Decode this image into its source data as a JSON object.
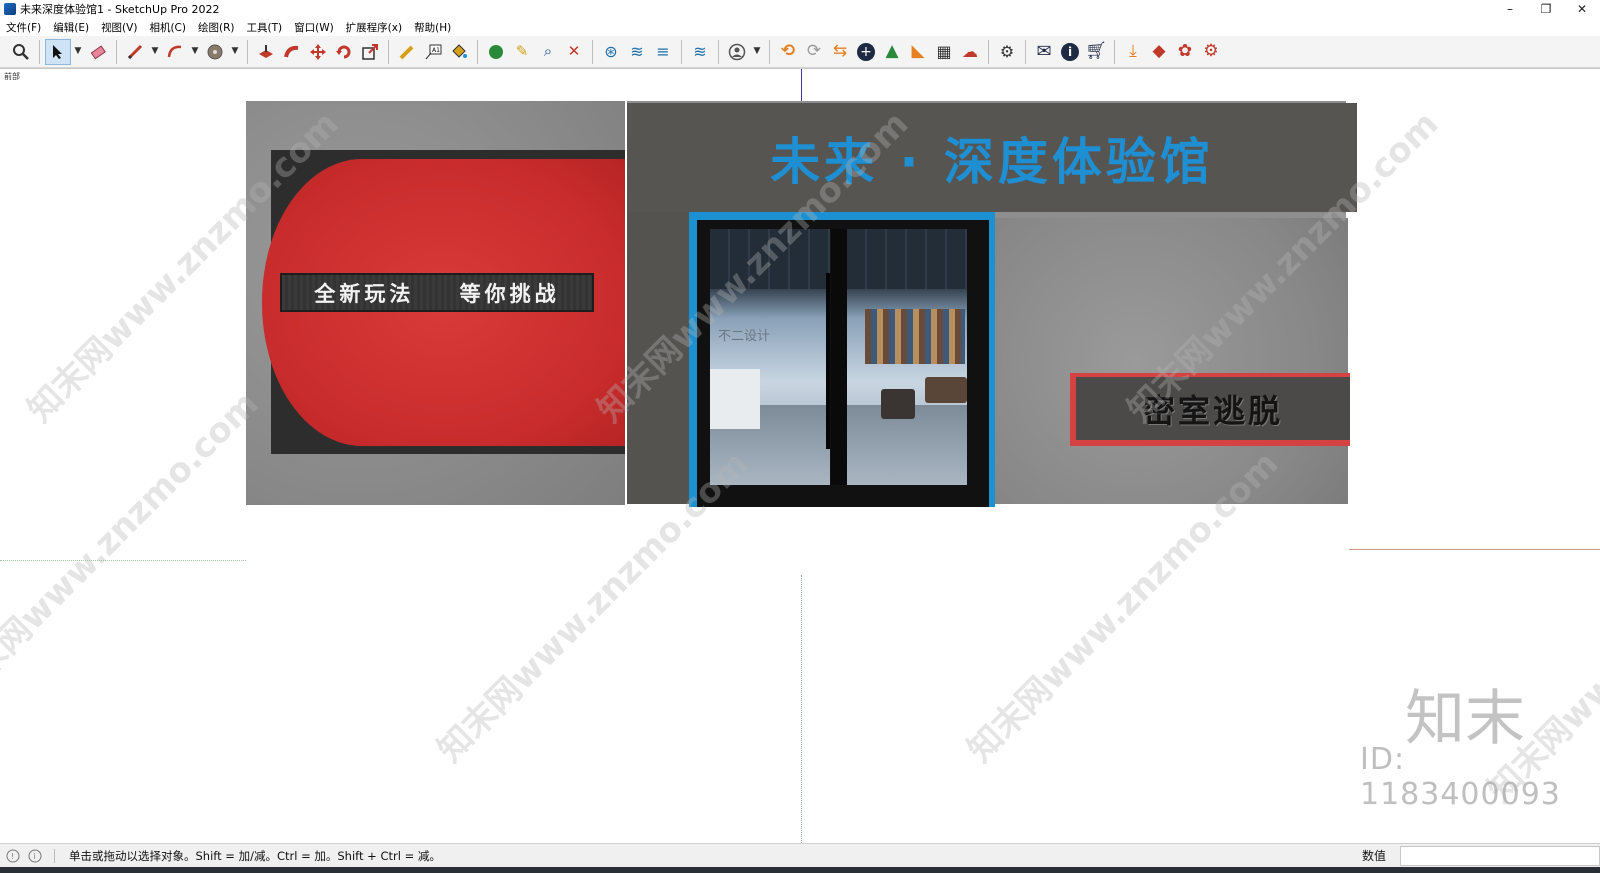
{
  "window": {
    "title": "未来深度体验馆1 - SketchUp Pro 2022",
    "minimize": "–",
    "restore": "❐",
    "close": "✕"
  },
  "menus": [
    "文件(F)",
    "编辑(E)",
    "视图(V)",
    "相机(C)",
    "绘图(R)",
    "工具(T)",
    "窗口(W)",
    "扩展程序(x)",
    "帮助(H)"
  ],
  "toolbar": {
    "zoom_icon": "magnifier-icon",
    "select_icon": "select-arrow-icon",
    "eraser_icon": "eraser-icon",
    "line_icon": "pencil-icon",
    "arc_icon": "arc-icon",
    "shape_icon": "circle-icon",
    "push_pull_icon": "push-pull-icon",
    "follow_me_icon": "follow-me-icon",
    "move_icon": "move-icon",
    "rotate_icon": "rotate-icon",
    "scale_icon": "scale-icon",
    "tape_icon": "tape-measure-icon",
    "text_icon": "text-icon",
    "paint_icon": "paint-bucket-icon",
    "accent_color": "#1b91d1"
  },
  "viewport": {
    "scene_tab": "前部"
  },
  "model": {
    "signboard": "未来 · 深度体验馆",
    "slogan": "全新玩法    等你挑战",
    "escape_sign": "密室逃脱",
    "interior_sign": "不二设计"
  },
  "watermark": {
    "site": "知末网www.znzmo.com",
    "logo": "知末",
    "id": "ID: 1183400093"
  },
  "statusbar": {
    "hint": "单击或拖动以选择对象。Shift = 加/减。Ctrl = 加。Shift + Ctrl = 减。",
    "vcb_label": "数值",
    "vcb_value": ""
  }
}
